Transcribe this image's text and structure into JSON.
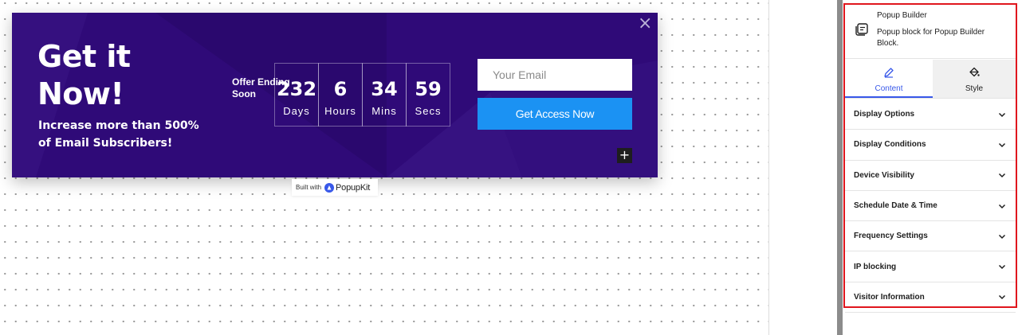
{
  "popup": {
    "close_icon": "close-icon",
    "headline": "Get it Now!",
    "subline": "Increase more than 500% of Email Subscribers!",
    "offer_label": "Offer Ending Soon",
    "countdown": [
      {
        "value": "232",
        "unit": "Days"
      },
      {
        "value": "6",
        "unit": "Hours"
      },
      {
        "value": "34",
        "unit": "Mins"
      },
      {
        "value": "59",
        "unit": "Secs"
      }
    ],
    "email_placeholder": "Your Email",
    "cta_label": "Get Access Now",
    "add_block_icon": "plus-icon",
    "colors": {
      "background": "#2f0a78",
      "cta": "#1b92f3"
    }
  },
  "builtwith": {
    "prefix": "Built with",
    "brand": "PopupKit"
  },
  "sidebar": {
    "block": {
      "title": "Popup Builder",
      "description": "Popup block for Popup Builder Block.",
      "icon": "popup-block-icon"
    },
    "tabs": [
      {
        "label": "Content",
        "icon": "pencil-icon",
        "active": true
      },
      {
        "label": "Style",
        "icon": "paint-bucket-icon",
        "active": false
      }
    ],
    "panels": [
      "Display Options",
      "Display Conditions",
      "Device Visibility",
      "Schedule Date & Time",
      "Frequency Settings",
      "IP blocking",
      "Visitor Information"
    ],
    "accent": "#3858e9",
    "highlight": "#e0161d"
  }
}
